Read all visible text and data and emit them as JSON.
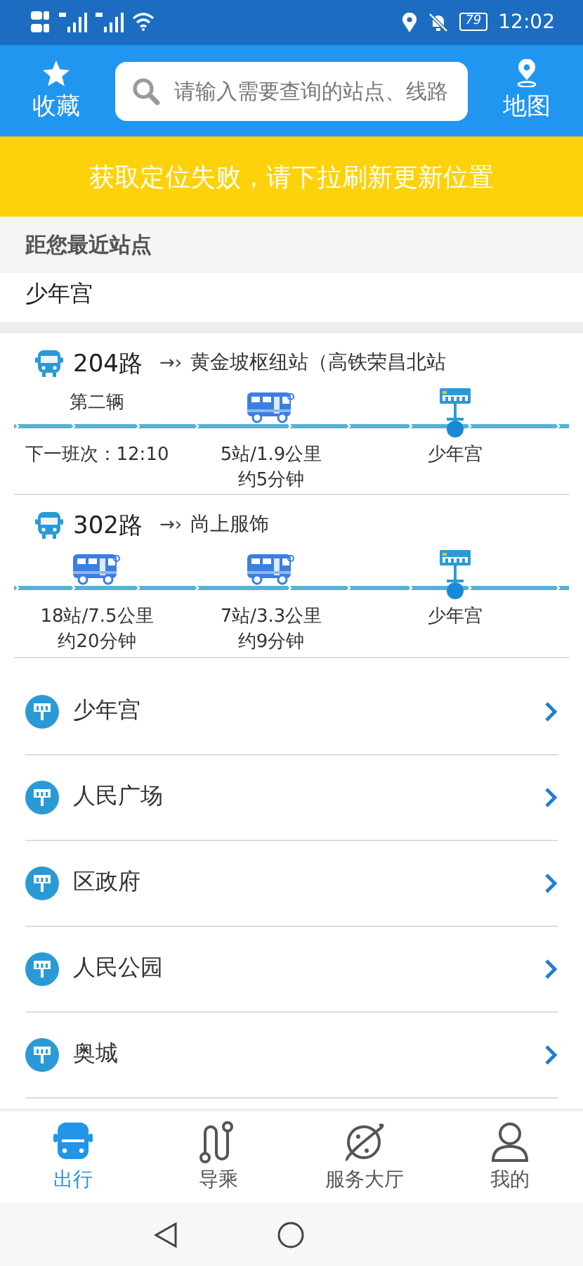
{
  "status_bar": {
    "battery": "79",
    "time": "12:02"
  },
  "header": {
    "favorites": "收藏",
    "search": {
      "placeholder": "请输入需要查询的站点、线路"
    },
    "map": "地图"
  },
  "banner": "获取定位失败，请下拉刷新更新位置",
  "nearest": {
    "title": "距您最近站点",
    "station": "少年宫"
  },
  "routes": [
    {
      "route": "204路",
      "arrow": "→›",
      "destination": "黄金坡枢纽站（高铁荣昌北站",
      "stops": [
        {
          "kind": "label",
          "label": "第二辆",
          "lines": [
            "下一班次：12:10"
          ]
        },
        {
          "kind": "bus",
          "lines": [
            "5站/1.9公里",
            "约5分钟"
          ]
        },
        {
          "kind": "station",
          "lines": [
            "少年宫"
          ]
        }
      ]
    },
    {
      "route": "302路",
      "arrow": "→›",
      "destination": "尚上服饰",
      "stops": [
        {
          "kind": "bus",
          "lines": [
            "18站/7.5公里",
            "约20分钟"
          ]
        },
        {
          "kind": "bus",
          "lines": [
            "7站/3.3公里",
            "约9分钟"
          ]
        },
        {
          "kind": "station",
          "lines": [
            "少年宫"
          ]
        }
      ]
    }
  ],
  "stations": [
    {
      "name": "少年宫"
    },
    {
      "name": "人民广场"
    },
    {
      "name": "区政府"
    },
    {
      "name": "人民公园"
    },
    {
      "name": "奥城"
    }
  ],
  "tabs": [
    {
      "label": "出行",
      "kind": "bus",
      "selected": true
    },
    {
      "label": "导乘",
      "kind": "route",
      "selected": false
    },
    {
      "label": "服务大厅",
      "kind": "planet",
      "selected": false
    },
    {
      "label": "我的",
      "kind": "person",
      "selected": false
    }
  ]
}
